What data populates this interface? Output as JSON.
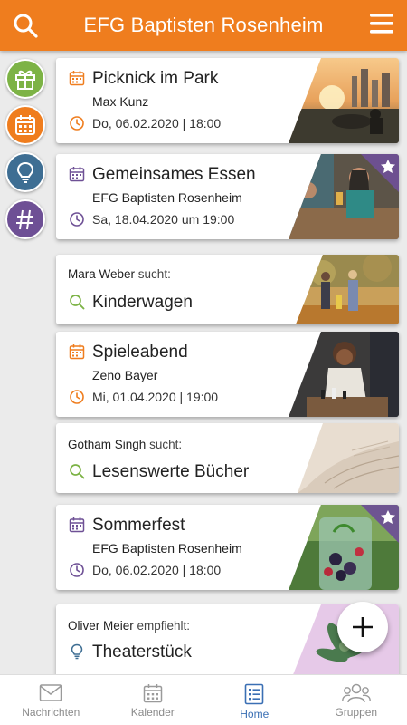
{
  "header": {
    "title": "EFG Baptisten Rosenheim"
  },
  "colors": {
    "accent": "#ef7d1e",
    "purple": "#6e5095",
    "green": "#7db346",
    "blue": "#3e6e93",
    "nav_active": "#3a6fb4"
  },
  "rail": [
    {
      "name": "gift-icon",
      "color": "#7db346"
    },
    {
      "name": "calendar-icon",
      "color": "#ef7d1e"
    },
    {
      "name": "lightbulb-icon",
      "color": "#3e6e93"
    },
    {
      "name": "hashtag-icon",
      "color": "#6e5095"
    }
  ],
  "cards": [
    {
      "kind": "event",
      "title": "Picknick im Park",
      "subtitle": "Max Kunz",
      "date": "Do, 06.02.2020 | 18:00",
      "color": "#ef7d1e",
      "starred": false,
      "photo": "park-sunset"
    },
    {
      "kind": "event",
      "title": "Gemeinsames Essen",
      "subtitle": "EFG Baptisten Rosenheim",
      "date": "Sa, 18.04.2020 um 19:00",
      "color": "#6e5095",
      "starred": true,
      "photo": "dinner"
    },
    {
      "kind": "search",
      "person": "Mara Weber",
      "verb": "sucht:",
      "title": "Kinderwagen",
      "color": "#7db346",
      "photo": "family-walk"
    },
    {
      "kind": "event",
      "title": "Spieleabend",
      "subtitle": "Zeno Bayer",
      "date": "Mi, 01.04.2020 | 19:00",
      "color": "#ef7d1e",
      "starred": false,
      "photo": "chess"
    },
    {
      "kind": "search",
      "person": "Gotham Singh",
      "verb": "sucht:",
      "title": "Lesenswerte Bücher",
      "color": "#7db346",
      "photo": "book"
    },
    {
      "kind": "event",
      "title": "Sommerfest",
      "subtitle": "EFG Baptisten Rosenheim",
      "date": "Do, 06.02.2020 | 18:00",
      "color": "#6e5095",
      "starred": true,
      "photo": "berries"
    },
    {
      "kind": "recommend",
      "person": "Oliver Meier",
      "verb": "empfiehlt:",
      "title": "Theaterstück",
      "color": "#3e6e93",
      "photo": "succulent"
    }
  ],
  "nav": [
    {
      "label": "Nachrichten",
      "icon": "envelope-icon",
      "active": false
    },
    {
      "label": "Kalender",
      "icon": "calendar-icon",
      "active": false
    },
    {
      "label": "Home",
      "icon": "home-list-icon",
      "active": true
    },
    {
      "label": "Gruppen",
      "icon": "group-icon",
      "active": false
    }
  ]
}
